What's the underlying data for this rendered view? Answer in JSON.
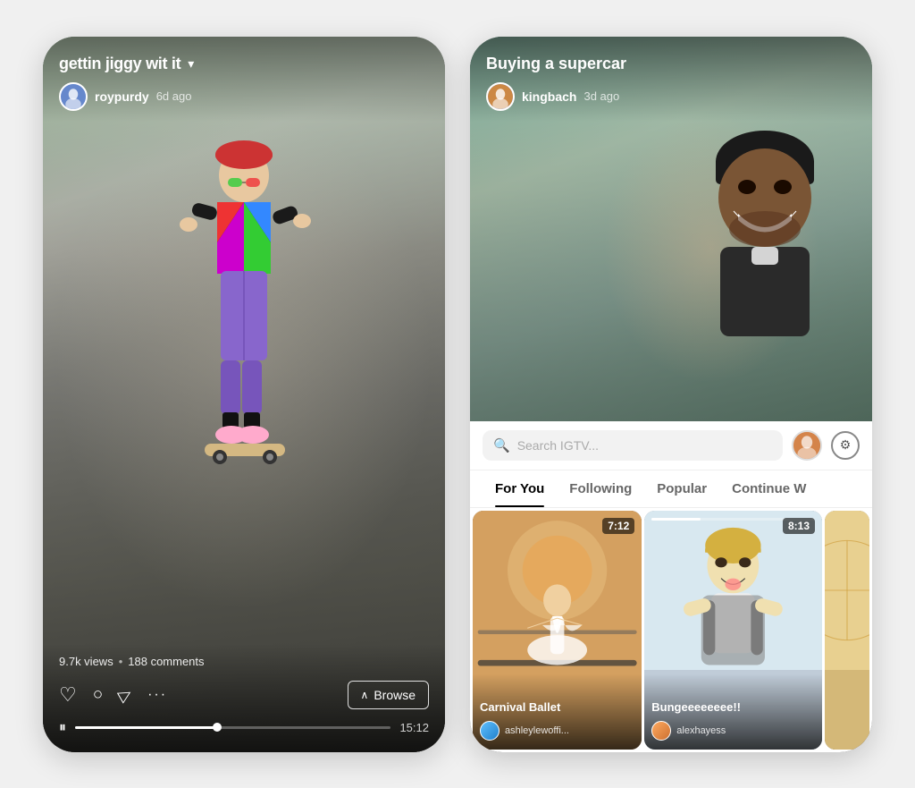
{
  "left_phone": {
    "title": "gettin jiggy wit it",
    "title_icon": "chevron-down",
    "user": {
      "name": "roypurdy",
      "time_ago": "6d ago"
    },
    "stats": {
      "views": "9.7k views",
      "comments": "188 comments"
    },
    "browse_label": "Browse",
    "duration": "15:12",
    "actions": {
      "like": "♡",
      "comment": "💬",
      "share": "➤",
      "more": "•••"
    }
  },
  "right_phone": {
    "title": "Buying a supercar",
    "user": {
      "name": "kingbach",
      "time_ago": "3d ago"
    },
    "search": {
      "placeholder": "Search IGTV..."
    },
    "tabs": [
      {
        "label": "For You",
        "active": true
      },
      {
        "label": "Following",
        "active": false
      },
      {
        "label": "Popular",
        "active": false
      },
      {
        "label": "Continue W",
        "active": false
      }
    ],
    "thumbnails": [
      {
        "title": "Carnival Ballet",
        "duration": "7:12",
        "username": "ashleylewoffi..."
      },
      {
        "title": "Bungeeeeeeee!!",
        "duration": "8:13",
        "username": "alexhayess"
      },
      {
        "title": "",
        "duration": "",
        "username": ""
      }
    ]
  }
}
